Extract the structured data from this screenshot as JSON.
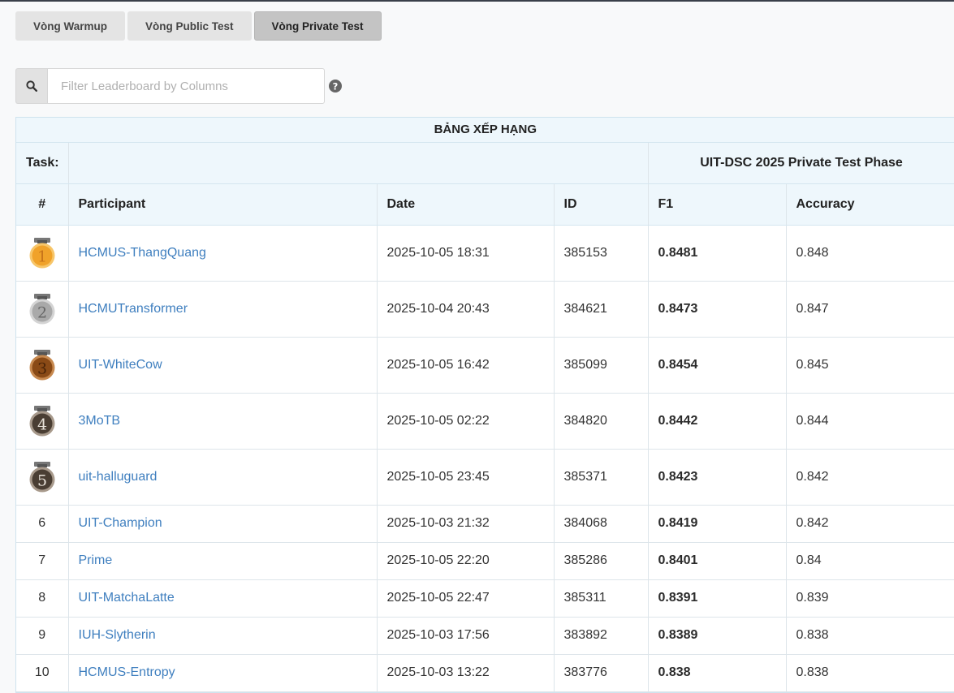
{
  "tabs": [
    {
      "label": "Vòng Warmup",
      "active": false
    },
    {
      "label": "Vòng Public Test",
      "active": false
    },
    {
      "label": "Vòng Private Test",
      "active": true
    }
  ],
  "search": {
    "placeholder": "Filter Leaderboard by Columns"
  },
  "icons": {
    "search": "search-icon",
    "help": "question-circle-icon",
    "medal": "medal-icon"
  },
  "colors": {
    "gold": "#f0a22a",
    "silver": "#a9a9a9",
    "bronze": "#8a4a16",
    "dark_medal": "#4a3e33",
    "link": "#3f7fbf"
  },
  "leaderboard": {
    "title": "BẢNG XẾP HẠNG",
    "task_label": "Task:",
    "phase": "UIT-DSC 2025 Private Test Phase",
    "columns": [
      "#",
      "Participant",
      "Date",
      "ID",
      "F1",
      "Accuracy"
    ],
    "rows": [
      {
        "rank": "1",
        "participant": "HCMUS-ThangQuang",
        "date": "2025-10-05 18:31",
        "id": "385153",
        "f1": "0.8481",
        "accuracy": "0.848"
      },
      {
        "rank": "2",
        "participant": "HCMUTransformer",
        "date": "2025-10-04 20:43",
        "id": "384621",
        "f1": "0.8473",
        "accuracy": "0.847"
      },
      {
        "rank": "3",
        "participant": "UIT-WhiteCow",
        "date": "2025-10-05 16:42",
        "id": "385099",
        "f1": "0.8454",
        "accuracy": "0.845"
      },
      {
        "rank": "4",
        "participant": "3MoTB",
        "date": "2025-10-05 02:22",
        "id": "384820",
        "f1": "0.8442",
        "accuracy": "0.844"
      },
      {
        "rank": "5",
        "participant": "uit-halluguard",
        "date": "2025-10-05 23:45",
        "id": "385371",
        "f1": "0.8423",
        "accuracy": "0.842"
      },
      {
        "rank": "6",
        "participant": "UIT-Champion",
        "date": "2025-10-03 21:32",
        "id": "384068",
        "f1": "0.8419",
        "accuracy": "0.842"
      },
      {
        "rank": "7",
        "participant": "Prime",
        "date": "2025-10-05 22:20",
        "id": "385286",
        "f1": "0.8401",
        "accuracy": "0.84"
      },
      {
        "rank": "8",
        "participant": "UIT-MatchaLatte",
        "date": "2025-10-05 22:47",
        "id": "385311",
        "f1": "0.8391",
        "accuracy": "0.839"
      },
      {
        "rank": "9",
        "participant": "IUH-Slytherin",
        "date": "2025-10-03 17:56",
        "id": "383892",
        "f1": "0.8389",
        "accuracy": "0.838"
      },
      {
        "rank": "10",
        "participant": "HCMUS-Entropy",
        "date": "2025-10-03 13:22",
        "id": "383776",
        "f1": "0.838",
        "accuracy": "0.838"
      }
    ]
  }
}
